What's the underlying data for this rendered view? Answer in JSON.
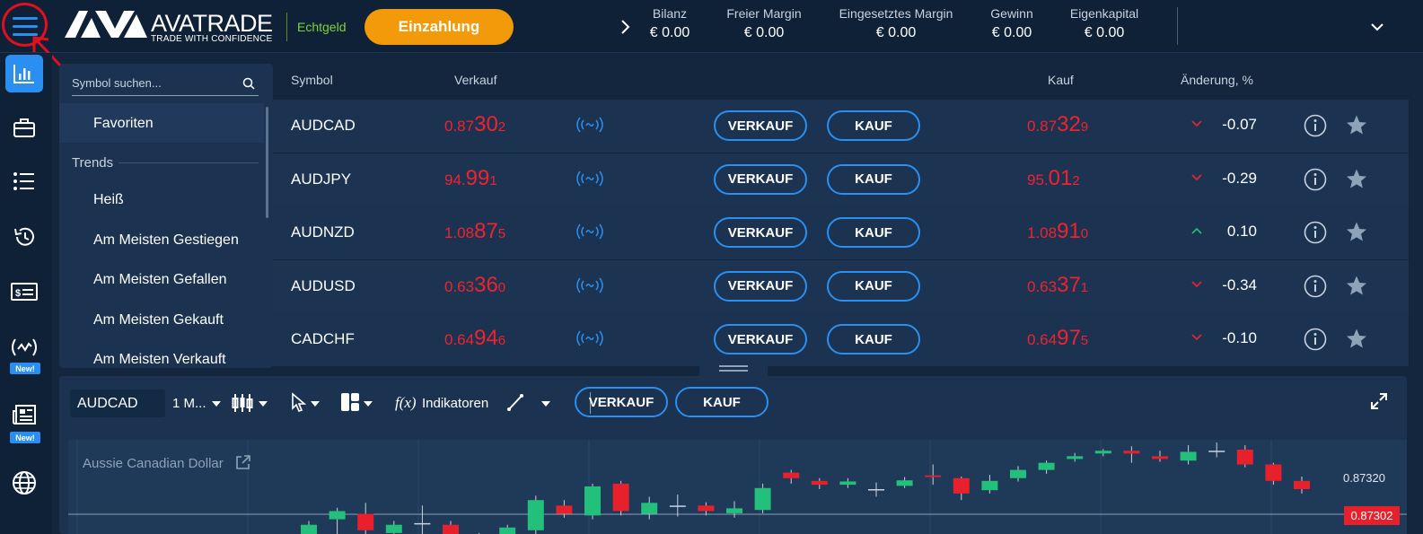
{
  "header": {
    "logo_main": "AVATRADE",
    "logo_sub": "TRADE WITH CONFIDENCE",
    "account_type": "Echtgeld",
    "deposit_label": "Einzahlung",
    "stats": [
      {
        "label": "Bilanz",
        "value": "€ 0.00"
      },
      {
        "label": "Freier Margin",
        "value": "€ 0.00"
      },
      {
        "label": "Eingesetztes Margin",
        "value": "€ 0.00"
      },
      {
        "label": "Gewinn",
        "value": "€ 0.00"
      },
      {
        "label": "Eigenkapital",
        "value": "€ 0.00"
      }
    ]
  },
  "rail": {
    "items": [
      "chart-icon",
      "briefcase-icon",
      "list-icon",
      "history-icon",
      "dollar-card-icon",
      "signal-icon",
      "newspaper-icon",
      "globe-icon"
    ],
    "new_badge": "New!"
  },
  "sidebar": {
    "search_placeholder": "Symbol suchen...",
    "favorites": "Favoriten",
    "trends_heading": "Trends",
    "items": [
      "Heiß",
      "Am Meisten Gestiegen",
      "Am Meisten Gefallen",
      "Am Meisten Gekauft",
      "Am Meisten Verkauft"
    ]
  },
  "table": {
    "columns": {
      "symbol": "Symbol",
      "sell": "Verkauf",
      "buy": "Kauf",
      "change": "Änderung, %"
    },
    "sell_button": "VERKAUF",
    "buy_button": "KAUF",
    "rows": [
      {
        "symbol": "AUDCAD",
        "sell": {
          "a": "0.87",
          "b": "30",
          "c": "2"
        },
        "buy": {
          "a": "0.87",
          "b": "32",
          "c": "9"
        },
        "direction": "down",
        "change": "-0.07"
      },
      {
        "symbol": "AUDJPY",
        "sell": {
          "a": "94.",
          "b": "99",
          "c": "1"
        },
        "buy": {
          "a": "95.",
          "b": "01",
          "c": "2"
        },
        "direction": "down",
        "change": "-0.29"
      },
      {
        "symbol": "AUDNZD",
        "sell": {
          "a": "1.08",
          "b": "87",
          "c": "5"
        },
        "buy": {
          "a": "1.08",
          "b": "91",
          "c": "0"
        },
        "direction": "up",
        "change": "0.10"
      },
      {
        "symbol": "AUDUSD",
        "sell": {
          "a": "0.63",
          "b": "36",
          "c": "0"
        },
        "buy": {
          "a": "0.63",
          "b": "37",
          "c": "1"
        },
        "direction": "down",
        "change": "-0.34"
      },
      {
        "symbol": "CADCHF",
        "sell": {
          "a": "0.64",
          "b": "94",
          "c": "6"
        },
        "buy": {
          "a": "0.64",
          "b": "97",
          "c": "5"
        },
        "direction": "down",
        "change": "-0.10"
      }
    ],
    "colors": {
      "price": "#f0222f",
      "accent": "#2a8ff0",
      "down": "#f0222f",
      "up": "#22c07a"
    }
  },
  "chart": {
    "symbol": "AUDCAD",
    "timeframe": "1 M...",
    "indicators_label": "Indikatoren",
    "sell_button": "VERKAUF",
    "buy_button": "KAUF",
    "title": "Aussie Canadian Dollar",
    "price_label": "0.87320",
    "last_price": "0.87302",
    "candles": [
      {
        "o": 0.8718,
        "c": 0.87205,
        "h": 0.87212,
        "l": 0.8716
      },
      {
        "o": 0.87215,
        "c": 0.8723,
        "h": 0.87236,
        "l": 0.8717
      },
      {
        "o": 0.87225,
        "c": 0.87195,
        "h": 0.87245,
        "l": 0.8718
      },
      {
        "o": 0.8719,
        "c": 0.87205,
        "h": 0.87212,
        "l": 0.8717
      },
      {
        "o": 0.87208,
        "c": 0.87208,
        "h": 0.8724,
        "l": 0.8718
      },
      {
        "o": 0.87205,
        "c": 0.87185,
        "h": 0.87212,
        "l": 0.8717
      },
      {
        "o": 0.87188,
        "c": 0.87188,
        "h": 0.8719,
        "l": 0.8717
      },
      {
        "o": 0.8718,
        "c": 0.872,
        "h": 0.87205,
        "l": 0.87175
      },
      {
        "o": 0.87195,
        "c": 0.8725,
        "h": 0.87258,
        "l": 0.87185
      },
      {
        "o": 0.8724,
        "c": 0.87225,
        "h": 0.8725,
        "l": 0.87218
      },
      {
        "o": 0.87222,
        "c": 0.87275,
        "h": 0.8728,
        "l": 0.87215
      },
      {
        "o": 0.8728,
        "c": 0.8723,
        "h": 0.87285,
        "l": 0.87222
      },
      {
        "o": 0.87225,
        "c": 0.87245,
        "h": 0.87256,
        "l": 0.87215
      },
      {
        "o": 0.8724,
        "c": 0.8724,
        "h": 0.8726,
        "l": 0.8722
      },
      {
        "o": 0.8724,
        "c": 0.8723,
        "h": 0.87246,
        "l": 0.87222
      },
      {
        "o": 0.87226,
        "c": 0.87235,
        "h": 0.87248,
        "l": 0.87218
      },
      {
        "o": 0.87232,
        "c": 0.87272,
        "h": 0.8728,
        "l": 0.87226
      },
      {
        "o": 0.873,
        "c": 0.8729,
        "h": 0.87305,
        "l": 0.8728
      },
      {
        "o": 0.87285,
        "c": 0.87278,
        "h": 0.8729,
        "l": 0.8727
      },
      {
        "o": 0.87278,
        "c": 0.87284,
        "h": 0.8729,
        "l": 0.87272
      },
      {
        "o": 0.8727,
        "c": 0.8727,
        "h": 0.87282,
        "l": 0.87256
      },
      {
        "o": 0.87276,
        "c": 0.87286,
        "h": 0.87292,
        "l": 0.87272
      },
      {
        "o": 0.87295,
        "c": 0.87292,
        "h": 0.87315,
        "l": 0.87278
      },
      {
        "o": 0.8729,
        "c": 0.87262,
        "h": 0.87293,
        "l": 0.8725
      },
      {
        "o": 0.87268,
        "c": 0.87285,
        "h": 0.87296,
        "l": 0.87262
      },
      {
        "o": 0.8729,
        "c": 0.87305,
        "h": 0.87312,
        "l": 0.87284
      },
      {
        "o": 0.87305,
        "c": 0.87318,
        "h": 0.87322,
        "l": 0.87298
      },
      {
        "o": 0.87325,
        "c": 0.8733,
        "h": 0.87336,
        "l": 0.8732
      },
      {
        "o": 0.87335,
        "c": 0.8734,
        "h": 0.87343,
        "l": 0.8733
      },
      {
        "o": 0.8734,
        "c": 0.87335,
        "h": 0.87348,
        "l": 0.87318
      },
      {
        "o": 0.8733,
        "c": 0.87325,
        "h": 0.8734,
        "l": 0.8732
      },
      {
        "o": 0.87322,
        "c": 0.87338,
        "h": 0.8735,
        "l": 0.87315
      },
      {
        "o": 0.8734,
        "c": 0.8734,
        "h": 0.87355,
        "l": 0.87328
      },
      {
        "o": 0.87342,
        "c": 0.87315,
        "h": 0.8735,
        "l": 0.8731
      },
      {
        "o": 0.87315,
        "c": 0.87285,
        "h": 0.87318,
        "l": 0.87278
      },
      {
        "o": 0.87285,
        "c": 0.8727,
        "h": 0.87293,
        "l": 0.87262
      }
    ]
  }
}
